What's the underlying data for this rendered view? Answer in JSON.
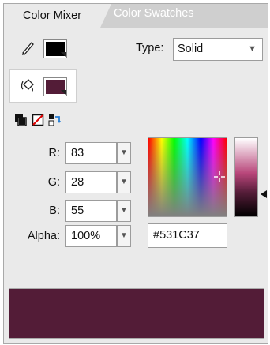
{
  "tabs": [
    {
      "label": "Color Mixer",
      "active": true
    },
    {
      "label": "Color Swatches",
      "active": false
    }
  ],
  "stroke": {
    "icon": "pencil-icon",
    "color": "#000000"
  },
  "fill": {
    "icon": "paint-bucket-icon",
    "color": "#531C37"
  },
  "type": {
    "label": "Type:",
    "value": "Solid"
  },
  "tools": [
    {
      "icon": "black-white-swatch-icon"
    },
    {
      "icon": "no-color-icon"
    },
    {
      "icon": "swap-colors-icon"
    }
  ],
  "channels": [
    {
      "label": "R:",
      "value": "83"
    },
    {
      "label": "G:",
      "value": "28"
    },
    {
      "label": "B:",
      "value": "55"
    },
    {
      "label": "Alpha:",
      "value": "100%"
    }
  ],
  "hex": "#531C37",
  "preview_color": "#531C37"
}
